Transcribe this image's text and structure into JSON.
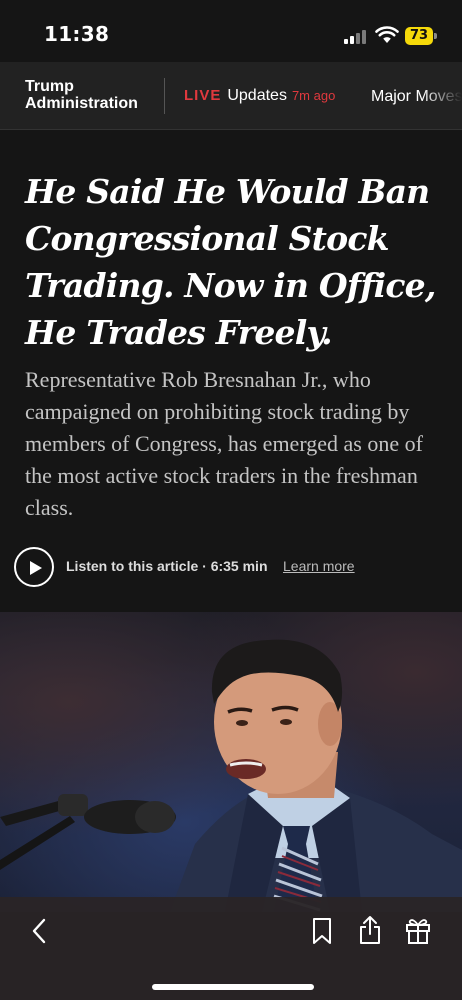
{
  "status_bar": {
    "time": "11:38",
    "battery": "73",
    "battery_color": "#f5d90a"
  },
  "section_nav": {
    "title_line1": "Trump",
    "title_line2": "Administration",
    "live_label": "LIVE",
    "live_updates": "Updates",
    "live_time": "7m ago",
    "next_item": "Major Moves",
    "live_color": "#e0393e"
  },
  "article": {
    "headline": "He Said He Would Ban Congressional Stock Trading. Now in Office, He Trades Freely.",
    "summary": "Representative Rob Bresnahan Jr., who campaigned on prohibiting stock trading by members of Congress, has emerged as one of the most active stock traders in the freshman class.",
    "listen_text": "Listen to this article · 6:35 min",
    "learn_more": "Learn more"
  },
  "toolbar": {
    "icons": [
      "back-icon",
      "bookmark-icon",
      "share-icon",
      "gift-icon"
    ]
  }
}
